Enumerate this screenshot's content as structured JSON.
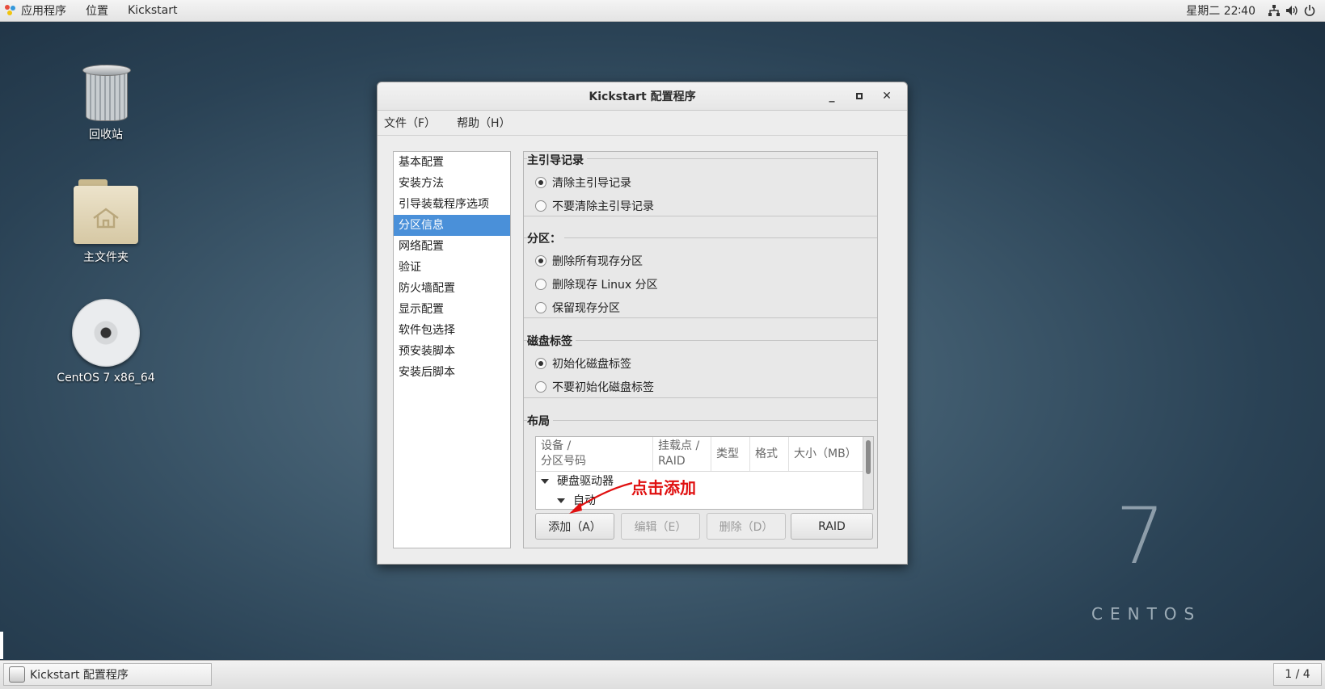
{
  "topbar": {
    "applications": "应用程序",
    "places": "位置",
    "active_app": "Kickstart",
    "clock": "星期二 22∶40",
    "tray_icons": [
      "network-icon",
      "volume-icon",
      "power-icon"
    ]
  },
  "desktop": {
    "trash_label": "回收站",
    "home_label": "主文件夹",
    "disc_label": "CentOS 7 x86_64"
  },
  "watermark": {
    "number": "7",
    "word": "CENTOS"
  },
  "window": {
    "title": "Kickstart 配置程序",
    "menu": {
      "file": "文件（F）",
      "help": "帮助（H）"
    },
    "sidebar": [
      "基本配置",
      "安装方法",
      "引导装载程序选项",
      "分区信息",
      "网络配置",
      "验证",
      "防火墙配置",
      "显示配置",
      "软件包选择",
      "预安装脚本",
      "安装后脚本"
    ],
    "sidebar_selected": "分区信息",
    "mbr": {
      "title": "主引导记录",
      "option1": "清除主引导记录",
      "option2": "不要清除主引导记录"
    },
    "partitions": {
      "title": "分区：",
      "option1": "删除所有现存分区",
      "option2": "删除现存  Linux 分区",
      "option3": "保留现存分区"
    },
    "disklabel": {
      "title": "磁盘标签",
      "option1": "初始化磁盘标签",
      "option2": "不要初始化磁盘标签"
    },
    "layout": {
      "title": "布局",
      "columns": {
        "device_line1": "设备 /",
        "device_line2": "分区号码",
        "mount_line1": "挂载点 /",
        "mount_line2": "RAID",
        "type": "类型",
        "format": "格式",
        "size": "大小（MB）"
      },
      "rows": [
        "硬盘驱动器",
        "自动"
      ]
    },
    "buttons": {
      "add": "添加（A）",
      "edit": "编辑（E）",
      "delete": "删除（D）",
      "raid": "RAID"
    }
  },
  "annotation": "点击添加",
  "taskbar": {
    "task": "Kickstart 配置程序",
    "pager": "1 / 4"
  },
  "colors": {
    "selection": "#4a90d9",
    "annotation": "#e01010"
  }
}
